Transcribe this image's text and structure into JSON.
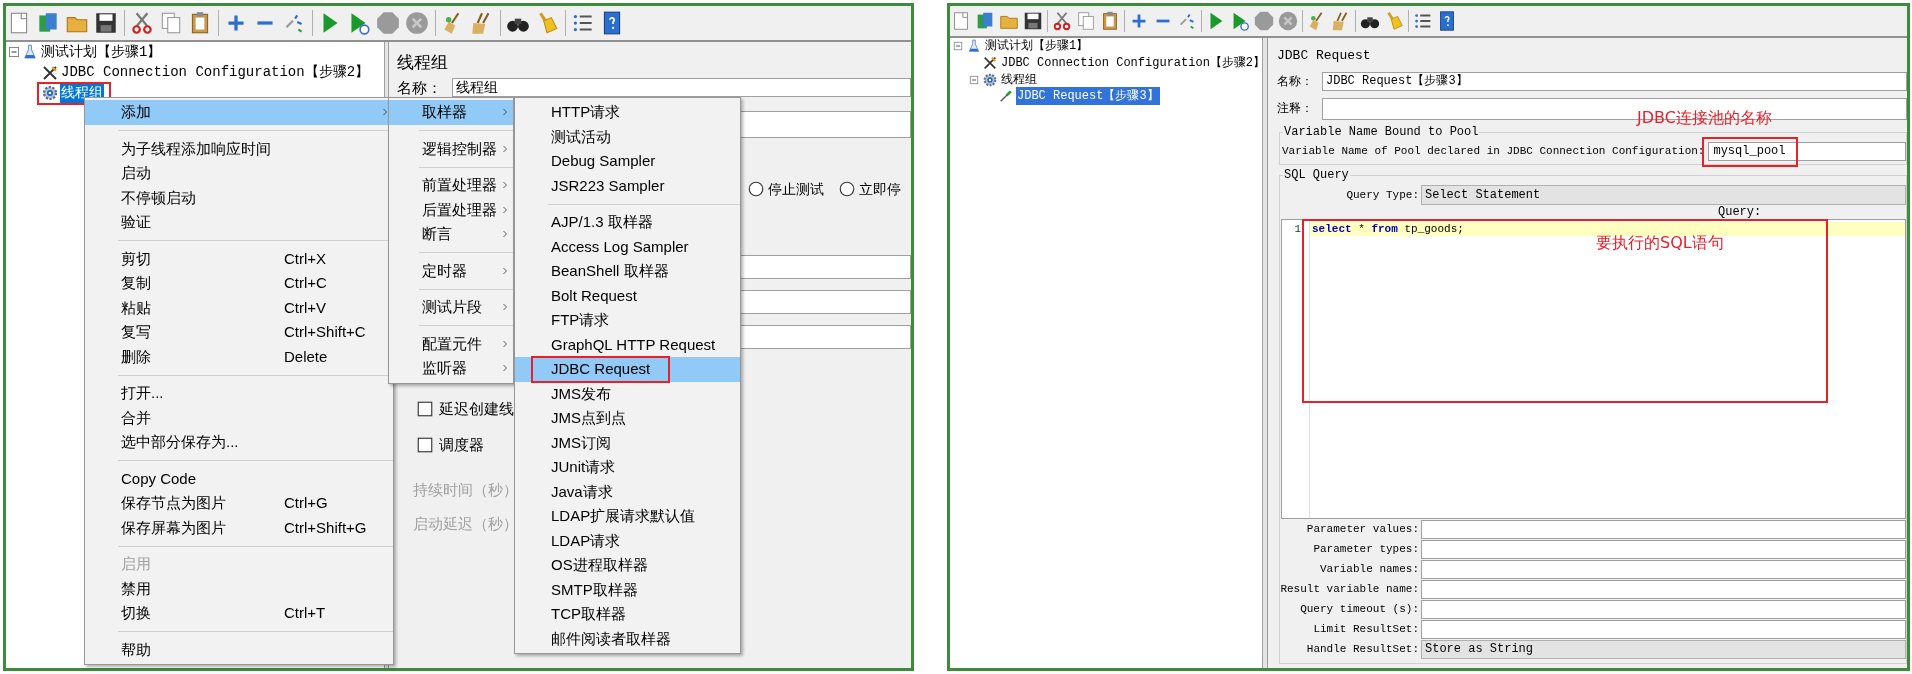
{
  "left_view": {
    "tree": [
      {
        "kind": "test_plan",
        "label": "测试计划【步骤1】",
        "selected": false,
        "expanded": true,
        "annotated": false,
        "children": [
          {
            "kind": "config",
            "label": "JDBC Connection Configuration【步骤2】",
            "selected": false,
            "annotated": false
          },
          {
            "kind": "thread_group",
            "label": "线程组",
            "selected": true,
            "annotated": true
          }
        ]
      }
    ],
    "editor": {
      "title": "线程组",
      "name_label": "名称：",
      "name_value": "线程组",
      "radios": [
        {
          "label": "停止测试",
          "selected": false
        },
        {
          "label": "立即停",
          "selected": false
        }
      ],
      "checkboxes": [
        {
          "label": "延迟创建线",
          "checked": false
        },
        {
          "label": "调度器",
          "checked": false
        }
      ],
      "labels": [
        {
          "text": "持续时间（秒）",
          "disabled": true
        },
        {
          "text": "启动延迟（秒）",
          "disabled": true
        }
      ]
    },
    "menus": [
      {
        "items": [
          {
            "kind": "item",
            "label": "添加",
            "submenu": true,
            "selected": true,
            "disabled": false
          },
          {
            "kind": "separator"
          },
          {
            "kind": "item",
            "label": "为子线程添加响应时间",
            "selected": false,
            "disabled": false
          },
          {
            "kind": "item",
            "label": "启动",
            "selected": false,
            "disabled": false
          },
          {
            "kind": "item",
            "label": "不停顿启动",
            "selected": false,
            "disabled": false
          },
          {
            "kind": "item",
            "label": "验证",
            "selected": false,
            "disabled": false
          },
          {
            "kind": "separator"
          },
          {
            "kind": "item",
            "label": "剪切",
            "shortcut": "Ctrl+X",
            "selected": false,
            "disabled": false
          },
          {
            "kind": "item",
            "label": "复制",
            "shortcut": "Ctrl+C",
            "selected": false,
            "disabled": false
          },
          {
            "kind": "item",
            "label": "粘贴",
            "shortcut": "Ctrl+V",
            "selected": false,
            "disabled": false
          },
          {
            "kind": "item",
            "label": "复写",
            "shortcut": "Ctrl+Shift+C",
            "selected": false,
            "disabled": false
          },
          {
            "kind": "item",
            "label": "删除",
            "shortcut": "Delete",
            "selected": false,
            "disabled": false
          },
          {
            "kind": "separator"
          },
          {
            "kind": "item",
            "label": "打开...",
            "selected": false,
            "disabled": false
          },
          {
            "kind": "item",
            "label": "合并",
            "selected": false,
            "disabled": false
          },
          {
            "kind": "item",
            "label": "选中部分保存为...",
            "selected": false,
            "disabled": false
          },
          {
            "kind": "separator"
          },
          {
            "kind": "item",
            "label": "Copy Code",
            "selected": false,
            "disabled": false
          },
          {
            "kind": "item",
            "label": "保存节点为图片",
            "shortcut": "Ctrl+G",
            "selected": false,
            "disabled": false
          },
          {
            "kind": "item",
            "label": "保存屏幕为图片",
            "shortcut": "Ctrl+Shift+G",
            "selected": false,
            "disabled": false
          },
          {
            "kind": "separator"
          },
          {
            "kind": "item",
            "label": "启用",
            "selected": false,
            "disabled": true
          },
          {
            "kind": "item",
            "label": "禁用",
            "selected": false,
            "disabled": false
          },
          {
            "kind": "item",
            "label": "切换",
            "shortcut": "Ctrl+T",
            "selected": false,
            "disabled": false
          },
          {
            "kind": "separator"
          },
          {
            "kind": "item",
            "label": "帮助",
            "selected": false,
            "disabled": false
          }
        ]
      },
      {
        "items": [
          {
            "kind": "item",
            "label": "取样器",
            "submenu": true,
            "selected": true
          },
          {
            "kind": "separator"
          },
          {
            "kind": "item",
            "label": "逻辑控制器",
            "submenu": true,
            "selected": false
          },
          {
            "kind": "separator"
          },
          {
            "kind": "item",
            "label": "前置处理器",
            "submenu": true,
            "selected": false
          },
          {
            "kind": "item",
            "label": "后置处理器",
            "submenu": true,
            "selected": false
          },
          {
            "kind": "item",
            "label": "断言",
            "submenu": true,
            "selected": false
          },
          {
            "kind": "separator"
          },
          {
            "kind": "item",
            "label": "定时器",
            "submenu": true,
            "selected": false
          },
          {
            "kind": "separator"
          },
          {
            "kind": "item",
            "label": "测试片段",
            "submenu": true,
            "selected": false
          },
          {
            "kind": "separator"
          },
          {
            "kind": "item",
            "label": "配置元件",
            "submenu": true,
            "selected": false
          },
          {
            "kind": "item",
            "label": "监听器",
            "submenu": true,
            "selected": false
          }
        ]
      },
      {
        "items": [
          {
            "kind": "item",
            "label": "HTTP请求",
            "selected": false,
            "annotated": false
          },
          {
            "kind": "item",
            "label": "测试活动",
            "selected": false,
            "annotated": false
          },
          {
            "kind": "item",
            "label": "Debug Sampler",
            "selected": false,
            "annotated": false
          },
          {
            "kind": "item",
            "label": "JSR223 Sampler",
            "selected": false,
            "annotated": false
          },
          {
            "kind": "separator"
          },
          {
            "kind": "item",
            "label": "AJP/1.3 取样器",
            "selected": false,
            "annotated": false
          },
          {
            "kind": "item",
            "label": "Access Log Sampler",
            "selected": false,
            "annotated": false
          },
          {
            "kind": "item",
            "label": "BeanShell 取样器",
            "selected": false,
            "annotated": false
          },
          {
            "kind": "item",
            "label": "Bolt Request",
            "selected": false,
            "annotated": false
          },
          {
            "kind": "item",
            "label": "FTP请求",
            "selected": false,
            "annotated": false
          },
          {
            "kind": "item",
            "label": "GraphQL HTTP Request",
            "selected": false,
            "annotated": false
          },
          {
            "kind": "item",
            "label": "JDBC Request",
            "selected": true,
            "annotated": true
          },
          {
            "kind": "item",
            "label": "JMS发布",
            "selected": false,
            "annotated": false
          },
          {
            "kind": "item",
            "label": "JMS点到点",
            "selected": false,
            "annotated": false
          },
          {
            "kind": "item",
            "label": "JMS订阅",
            "selected": false,
            "annotated": false
          },
          {
            "kind": "item",
            "label": "JUnit请求",
            "selected": false,
            "annotated": false
          },
          {
            "kind": "item",
            "label": "Java请求",
            "selected": false,
            "annotated": false
          },
          {
            "kind": "item",
            "label": "LDAP扩展请求默认值",
            "selected": false,
            "annotated": false
          },
          {
            "kind": "item",
            "label": "LDAP请求",
            "selected": false,
            "annotated": false
          },
          {
            "kind": "item",
            "label": "OS进程取样器",
            "selected": false,
            "annotated": false
          },
          {
            "kind": "item",
            "label": "SMTP取样器",
            "selected": false,
            "annotated": false
          },
          {
            "kind": "item",
            "label": "TCP取样器",
            "selected": false,
            "annotated": false
          },
          {
            "kind": "item",
            "label": "邮件阅读者取样器",
            "selected": false,
            "annotated": false
          }
        ]
      }
    ]
  },
  "right_view": {
    "tree": [
      {
        "kind": "test_plan",
        "label": "测试计划【步骤1】",
        "selected": false,
        "expanded": true,
        "children": [
          {
            "kind": "config",
            "label": "JDBC Connection Configuration【步骤2】",
            "selected": false
          },
          {
            "kind": "thread_group",
            "label": "线程组",
            "selected": false,
            "expanded": true,
            "children": [
              {
                "kind": "sampler",
                "label": "JDBC Request【步骤3】",
                "selected": true
              }
            ]
          }
        ]
      }
    ],
    "request": {
      "title": "JDBC Request",
      "name_label": "名称：",
      "name_value": "JDBC Request【步骤3】",
      "comment_label": "注释：",
      "pool_group": "Variable Name Bound to Pool",
      "pool_label": "Variable Name of Pool declared in JDBC Connection Configuration:",
      "pool_value": "mysql_pool",
      "pool_note": "JDBC连接池的名称",
      "sql_group": "SQL Query",
      "query_type_label": "Query Type:",
      "query_type_value": "Select Statement",
      "query_label": "Query:",
      "lines": [
        {
          "number": "1",
          "current": true,
          "tokens": [
            {
              "text": "select",
              "kind": "keyword"
            },
            {
              "text": " * ",
              "kind": "plain"
            },
            {
              "text": "from",
              "kind": "keyword"
            },
            {
              "text": " tp_goods;",
              "kind": "plain"
            }
          ]
        }
      ],
      "sql_note": "要执行的SQL语句",
      "params": [
        {
          "kind": "field",
          "label": "Parameter values:"
        },
        {
          "kind": "field",
          "label": "Parameter types:"
        },
        {
          "kind": "field",
          "label": "Variable names:"
        },
        {
          "kind": "field",
          "label": "Result variable name:"
        },
        {
          "kind": "field",
          "label": "Query timeout (s):"
        },
        {
          "kind": "field",
          "label": "Limit ResultSet:"
        },
        {
          "kind": "combo",
          "label": "Handle ResultSet:",
          "value": "Store as String"
        }
      ]
    }
  }
}
